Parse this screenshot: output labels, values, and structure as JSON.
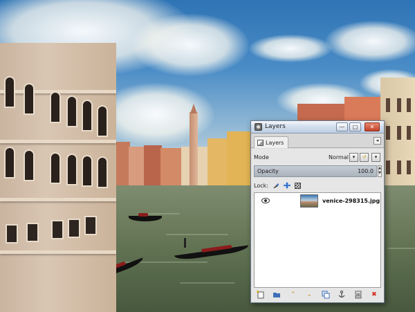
{
  "window": {
    "title": "Layers",
    "buttons": [
      "minimize",
      "maximize",
      "close"
    ]
  },
  "tabs": [
    {
      "label": "Layers",
      "icon": "layers-icon",
      "active": true
    }
  ],
  "mode": {
    "label": "Mode",
    "value": "Normal"
  },
  "opacity": {
    "label": "Opacity",
    "value": "100.0",
    "level": 1.0
  },
  "lock": {
    "label": "Lock:",
    "options": [
      "lock-pixels-icon",
      "lock-position-icon",
      "lock-alpha-icon"
    ]
  },
  "layers": [
    {
      "name": "venice-298315.jpg",
      "visible": true
    }
  ],
  "bottom_toolbar": [
    "new-layer-icon",
    "new-layer-group-icon",
    "raise-layer-icon",
    "lower-layer-icon",
    "duplicate-layer-icon",
    "anchor-layer-icon",
    "merge-down-icon",
    "delete-layer-icon"
  ],
  "colors": {
    "delete": "#d42a1f",
    "arrow": "#c9821f",
    "titlebar": "#d4dfee"
  }
}
